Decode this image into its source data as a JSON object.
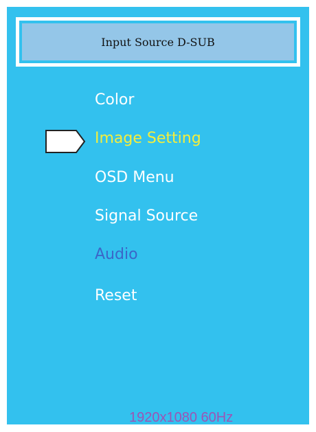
{
  "header": {
    "title": "Input Source D-SUB"
  },
  "menu": {
    "items": [
      {
        "label": "Color",
        "state": "normal"
      },
      {
        "label": "Image Setting",
        "state": "selected"
      },
      {
        "label": "OSD Menu",
        "state": "normal"
      },
      {
        "label": "Signal Source",
        "state": "normal"
      },
      {
        "label": "Audio",
        "state": "disabled"
      },
      {
        "label": "Reset",
        "state": "normal"
      }
    ],
    "selection_indicator": "arrow-pointer-icon"
  },
  "status": {
    "resolution": "1920x1080 60Hz"
  },
  "colors": {
    "background": "#33c1ee",
    "header_fill": "#94c6e8",
    "header_border": "#ffffff",
    "text_normal": "#ffffff",
    "text_selected": "#f5ee3b",
    "text_disabled": "#3b66c8",
    "status_text": "#9c54b5"
  }
}
